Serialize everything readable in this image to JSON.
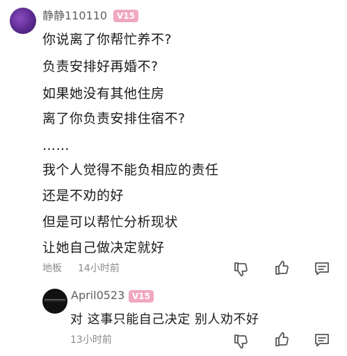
{
  "comment": {
    "username": "静静110110",
    "badge": "V15",
    "lines": [
      "你说离了你帮忙养不?",
      "负责安排好再婚不?",
      "如果她没有其他住房",
      "离了你负责安排住宿不?",
      "……",
      "我个人觉得不能负相应的责任",
      "还是不劝的好",
      "但是可以帮忙分析现状",
      "让她自己做决定就好"
    ],
    "location": "地板",
    "time": "14小时前"
  },
  "reply": {
    "username": "April0523",
    "badge": "V15",
    "text": "对 这事只能自己决定 别人劝不好",
    "time": "13小时前"
  },
  "icons": {
    "dislike": "thumbs-down-icon",
    "like": "thumbs-up-icon",
    "reply": "comment-icon"
  },
  "colors": {
    "badge": "#f0a8be",
    "username": "#5f5f5f",
    "meta": "#8a8a8a",
    "text": "#1a1a1a"
  }
}
